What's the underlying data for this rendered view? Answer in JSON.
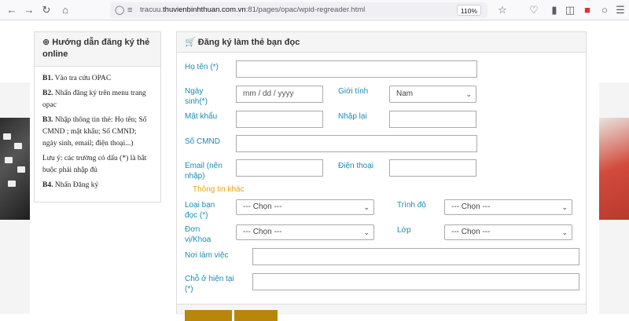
{
  "browser": {
    "url_prefix": "tracuu.",
    "url_host": "thuvienbinhthuan.com.vn",
    "url_rest": ":81/pages/opac/wpid-regreader.html",
    "zoom": "110%"
  },
  "guide": {
    "title": "Hướng dẫn đăng ký thẻ online",
    "steps": [
      {
        "key": "B1.",
        "text": " Vào tra cứu OPAC"
      },
      {
        "key": "B2.",
        "text": " Nhấn đăng ký trên menu trang opac"
      },
      {
        "key": "B3.",
        "text": " Nhập thông tin thẻ: Họ tên; Số CMND ; mật khẩu; Số CMND; ngày sinh, email; điện thoại...)"
      },
      {
        "key": "",
        "text": "Lưu ý: các trường có dấu (*) là bắt buộc phải nhập đủ"
      },
      {
        "key": "B4.",
        "text": " Nhấn Đăng ký"
      }
    ]
  },
  "form": {
    "title": "Đăng ký làm thẻ bạn đọc",
    "labels": {
      "hoten": "Họ tên (*)",
      "ngaysinh": "Ngày sinh(*)",
      "gioitinh": "Giới tính",
      "matkhau": "Mật khẩu",
      "nhaplai": "Nhập lại",
      "cmnd": "Số CMND",
      "email": "Email (nên nhập)",
      "dienthoai": "Điện thoại",
      "loaibandoc": "Loại bạn đọc (*)",
      "trinhdo": "Trình độ",
      "donvi": "Đơn vị/Khoa",
      "lop": "Lớp",
      "noilamviec": "Nơi làm việc",
      "choohientai": "Chỗ ở hiện tại (*)"
    },
    "section_other": "Thông tin khác",
    "date_placeholder": "mm / dd / yyyy",
    "gender_value": "Nam",
    "select_default": "--- Chọn ---"
  }
}
